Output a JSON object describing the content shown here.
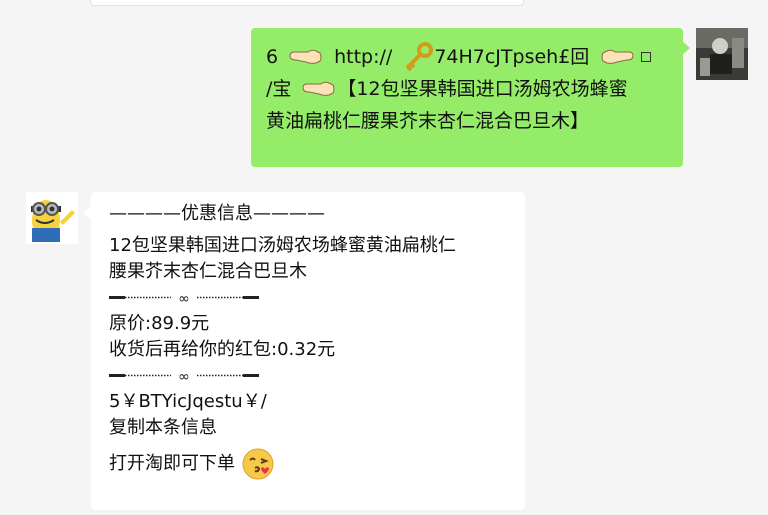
{
  "green_message": {
    "line1": {
      "prefix": "6",
      "url_text": "http://",
      "code": "74H7cJTpseh£回"
    },
    "line2": {
      "prefix": "/宝",
      "title": "【12包坚果韩国进口汤姆农场蜂蜜"
    },
    "line3": "黄油扁桃仁腰果芥末杏仁混合巴旦木】"
  },
  "white_message": {
    "header": "————优惠信息————",
    "product_line1": "12包坚果韩国进口汤姆农场蜂蜜黄油扁桃仁",
    "product_line2": "腰果芥末杏仁混合巴旦木",
    "price": "原价:89.9元",
    "redpacket": "收货后再给你的红包:0.32元",
    "code": "5￥BTYicJqestu￥/",
    "copy_hint": "复制本条信息",
    "open_hint": "打开淘即可下单"
  },
  "colors": {
    "green_bubble": "#95ec69",
    "white_bubble": "#ffffff",
    "background": "#f5f5f5"
  },
  "icons": [
    "pointing-hand-left-icon",
    "key-icon",
    "pointing-hand-right-icon",
    "kiss-face-icon",
    "infinity-separator-icon"
  ]
}
